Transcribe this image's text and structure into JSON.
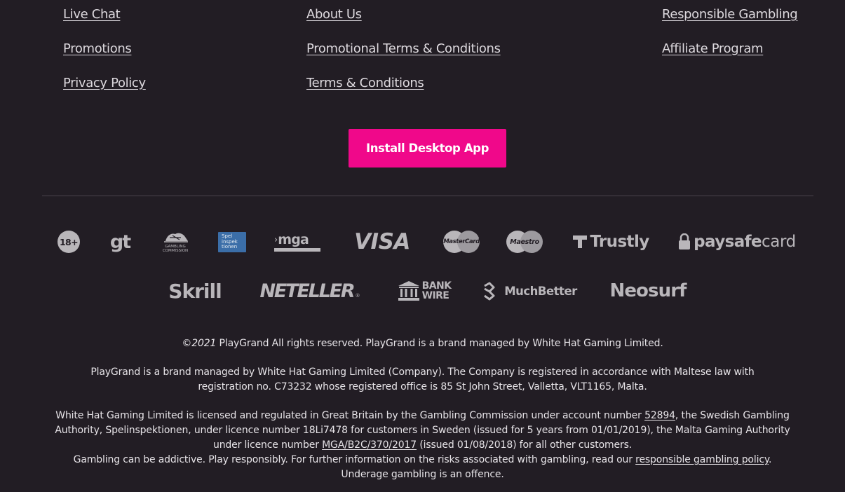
{
  "links": {
    "col1": [
      "Live Chat",
      "Promotions",
      "Privacy Policy"
    ],
    "col2": [
      "About Us",
      "Promotional Terms & Conditions",
      "Terms & Conditions"
    ],
    "col3": [
      "Responsible Gambling",
      "Affiliate Program"
    ]
  },
  "install_button": "Install Desktop App",
  "logos": {
    "age": "18+",
    "gt": "gt",
    "gambling_commission": "GAMBLING COMMISSION",
    "spelinspektionen": "Spel inspek tionen",
    "mga": "mga",
    "visa": "VISA",
    "mastercard": "MasterCard",
    "maestro": "Maestro",
    "trustly": "Trustly",
    "paysafecard_a": "paysafe",
    "paysafecard_b": "card",
    "skrill": "Skrill",
    "neteller": "NETELLER",
    "bankwire_a": "BANK",
    "bankwire_b": "WIRE",
    "muchbetter": "MuchBetter",
    "neosurf": "Neosurf"
  },
  "footer": {
    "copyright_symbol": "©",
    "copyright_year": "2021",
    "copyright_rest": " PlayGrand All rights reserved. PlayGrand is a brand managed by White Hat Gaming Limited.",
    "company_para": "PlayGrand is a brand managed by White Hat Gaming Limited (Company). The Company is registered in accordance with Maltese law with registration no. C73232 whose registered office is 85 St John Street, Valletta, VLT1165, Malta.",
    "license_1": "White Hat Gaming Limited is licensed and regulated in Great Britain by the Gambling Commission under account number ",
    "license_link_1": "52894",
    "license_2": ", the Swedish Gambling Authority, Spelinspektionen, under licence number 18Li7478 for customers in Sweden (issued for 5 years from 01/01/2019), the Malta Gaming Authority under licence number ",
    "license_link_2": "MGA/B2C/370/2017",
    "license_3": " (issued 01/08/2018) for all other customers.",
    "addictive_1": "Gambling can be addictive. Play responsibly. For further information on the risks associated with gambling, read our ",
    "addictive_link": "responsible gambling policy",
    "addictive_2": ".",
    "underage": "Underage gambling is an offence."
  }
}
